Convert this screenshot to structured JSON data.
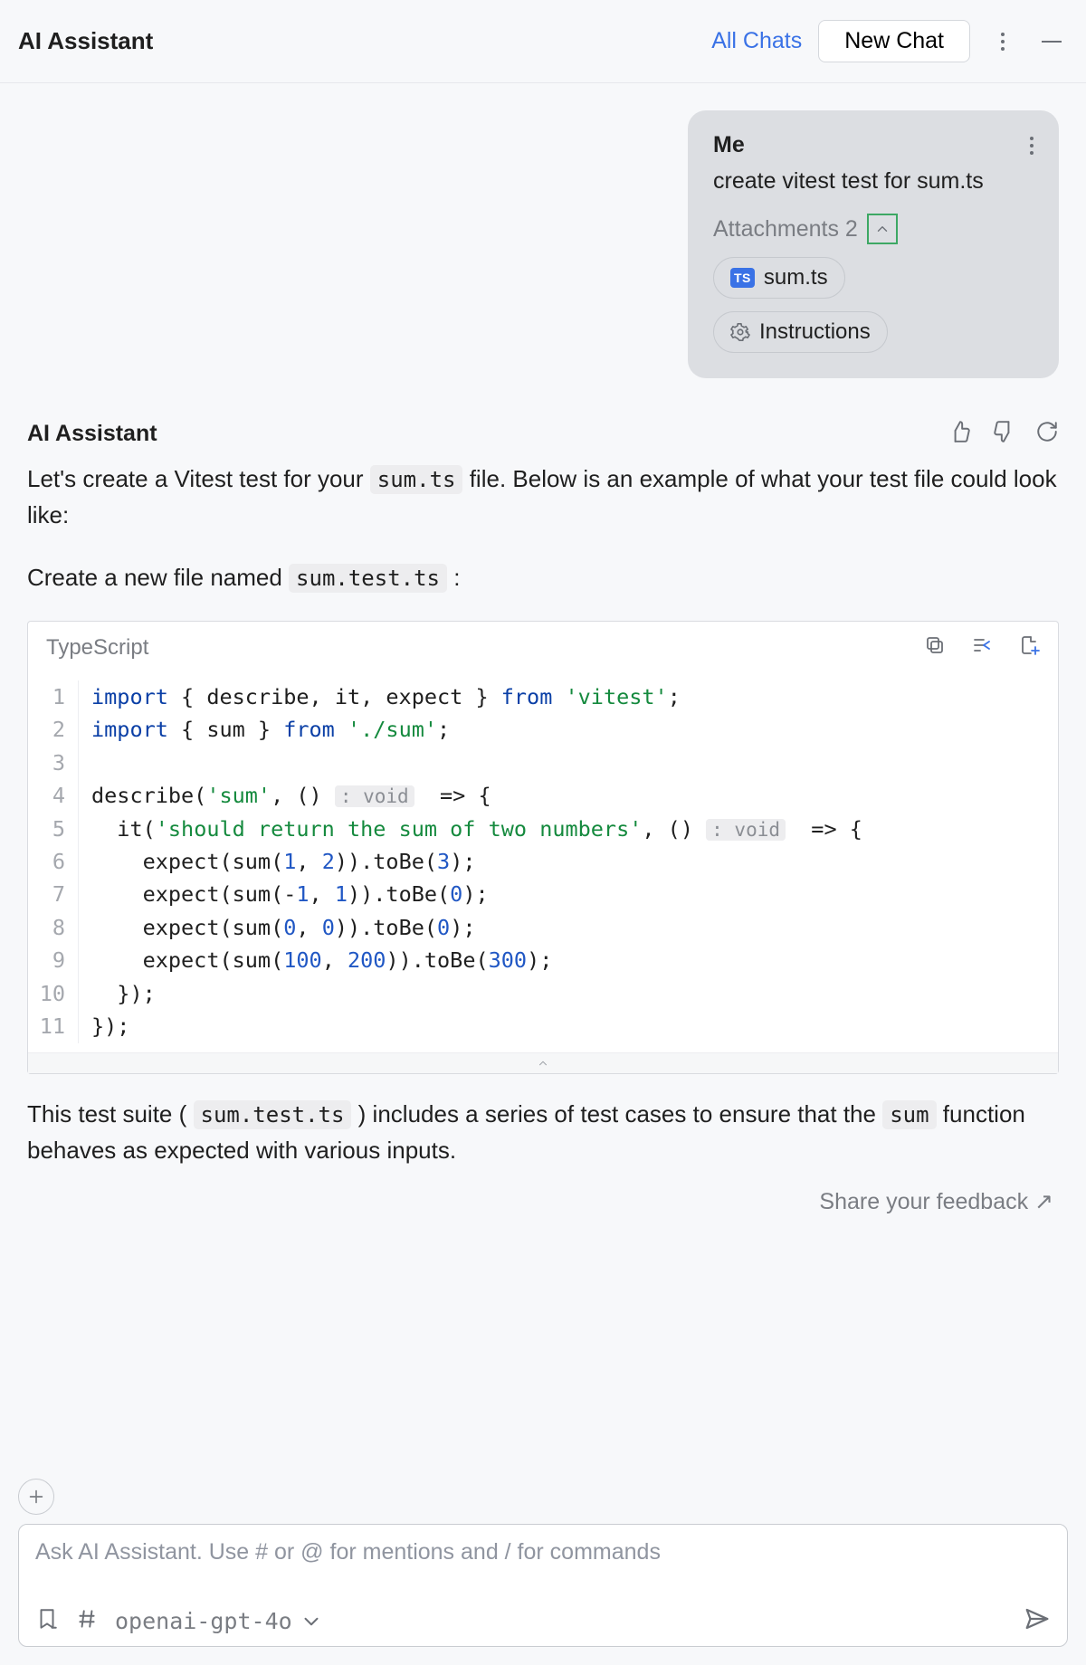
{
  "header": {
    "title": "AI Assistant",
    "all_chats": "All Chats",
    "new_chat": "New Chat"
  },
  "me": {
    "name": "Me",
    "text": "create vitest test for sum.ts",
    "attachments_label": "Attachments 2",
    "chip_file": "sum.ts",
    "chip_instructions": "Instructions"
  },
  "assistant": {
    "name": "AI Assistant",
    "p1_a": "Let's create a Vitest test for your ",
    "p1_code": "sum.ts",
    "p1_b": " file. Below is an example of what your test file could look like:",
    "p2_a": "Create a new file named ",
    "p2_code": "sum.test.ts",
    "p2_b": " :",
    "p3_a": "This test suite ( ",
    "p3_code": "sum.test.ts",
    "p3_b": " ) includes a series of test cases to ensure that the ",
    "p3_code2": "sum",
    "p3_c": " function behaves as expected with various inputs."
  },
  "code": {
    "lang": "TypeScript",
    "lines": [
      {
        "n": "1",
        "tokens": [
          {
            "t": "import",
            "c": "kw"
          },
          {
            "t": " { describe, it, expect } "
          },
          {
            "t": "from",
            "c": "kw"
          },
          {
            "t": " "
          },
          {
            "t": "'vitest'",
            "c": "str"
          },
          {
            "t": ";"
          }
        ]
      },
      {
        "n": "2",
        "tokens": [
          {
            "t": "import",
            "c": "kw"
          },
          {
            "t": " { sum } "
          },
          {
            "t": "from",
            "c": "kw"
          },
          {
            "t": " "
          },
          {
            "t": "'./sum'",
            "c": "str"
          },
          {
            "t": ";"
          }
        ]
      },
      {
        "n": "3",
        "tokens": [
          {
            "t": ""
          }
        ]
      },
      {
        "n": "4",
        "tokens": [
          {
            "t": "describe("
          },
          {
            "t": "'sum'",
            "c": "str"
          },
          {
            "t": ", () "
          },
          {
            "t": ": void",
            "c": "hint"
          },
          {
            "t": "  => {"
          }
        ]
      },
      {
        "n": "5",
        "tokens": [
          {
            "t": "  it("
          },
          {
            "t": "'should return the sum of two numbers'",
            "c": "str"
          },
          {
            "t": ", () "
          },
          {
            "t": ": void",
            "c": "hint"
          },
          {
            "t": "  => {"
          }
        ]
      },
      {
        "n": "6",
        "tokens": [
          {
            "t": "    expect(sum("
          },
          {
            "t": "1",
            "c": "num"
          },
          {
            "t": ", "
          },
          {
            "t": "2",
            "c": "num"
          },
          {
            "t": ")).toBe("
          },
          {
            "t": "3",
            "c": "num"
          },
          {
            "t": ");"
          }
        ]
      },
      {
        "n": "7",
        "tokens": [
          {
            "t": "    expect(sum(-"
          },
          {
            "t": "1",
            "c": "num"
          },
          {
            "t": ", "
          },
          {
            "t": "1",
            "c": "num"
          },
          {
            "t": ")).toBe("
          },
          {
            "t": "0",
            "c": "num"
          },
          {
            "t": ");"
          }
        ]
      },
      {
        "n": "8",
        "tokens": [
          {
            "t": "    expect(sum("
          },
          {
            "t": "0",
            "c": "num"
          },
          {
            "t": ", "
          },
          {
            "t": "0",
            "c": "num"
          },
          {
            "t": ")).toBe("
          },
          {
            "t": "0",
            "c": "num"
          },
          {
            "t": ");"
          }
        ]
      },
      {
        "n": "9",
        "tokens": [
          {
            "t": "    expect(sum("
          },
          {
            "t": "100",
            "c": "num"
          },
          {
            "t": ", "
          },
          {
            "t": "200",
            "c": "num"
          },
          {
            "t": ")).toBe("
          },
          {
            "t": "300",
            "c": "num"
          },
          {
            "t": ");"
          }
        ]
      },
      {
        "n": "10",
        "tokens": [
          {
            "t": "  });"
          }
        ]
      },
      {
        "n": "11",
        "tokens": [
          {
            "t": "});"
          }
        ]
      }
    ]
  },
  "feedback": {
    "label": "Share your feedback ↗"
  },
  "composer": {
    "placeholder": "Ask AI Assistant. Use # or @ for mentions and / for commands",
    "model": "openai-gpt-4o"
  }
}
